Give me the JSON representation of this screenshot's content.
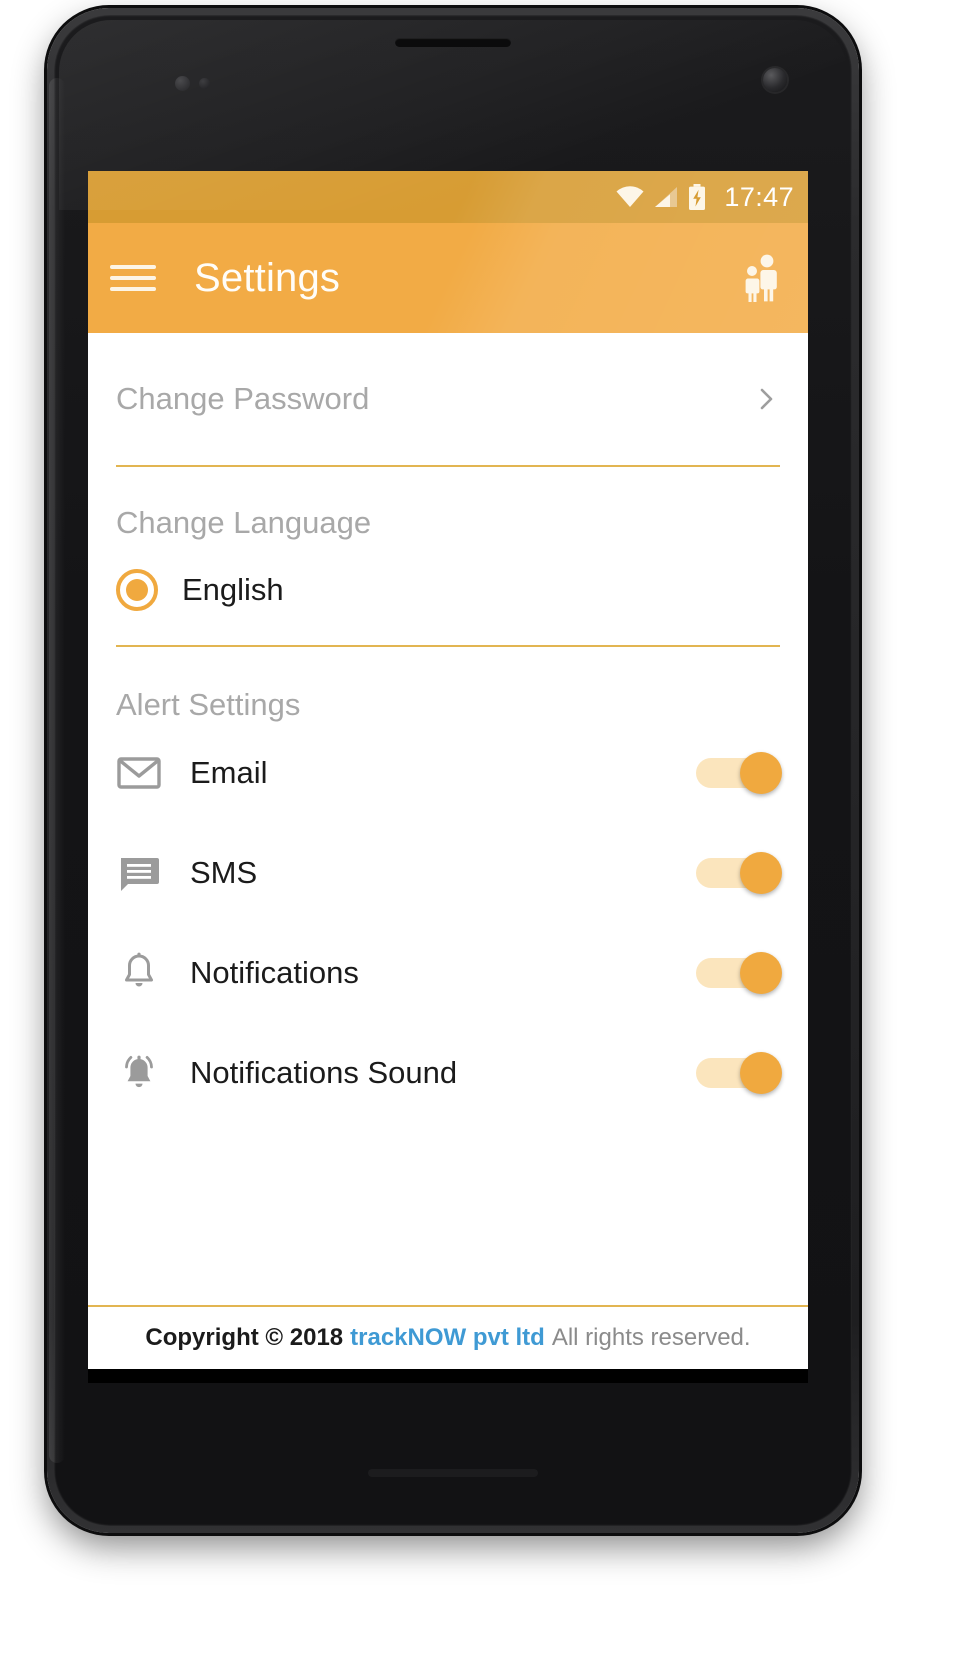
{
  "statusbar": {
    "time": "17:47",
    "icons": [
      "wifi-icon",
      "signal-icon",
      "battery-charging-icon"
    ]
  },
  "appbar": {
    "menu_icon": "hamburger-menu-icon",
    "title": "Settings",
    "right_icon": "family-icon",
    "background_color": "#f2ab45"
  },
  "content": {
    "change_password": {
      "label": "Change Password",
      "chevron_icon": "chevron-right-icon"
    },
    "change_language": {
      "heading": "Change Language",
      "options": [
        {
          "label": "English",
          "selected": true
        }
      ]
    },
    "alert_settings": {
      "heading": "Alert Settings",
      "items": [
        {
          "icon": "email-icon",
          "label": "Email",
          "enabled": true
        },
        {
          "icon": "sms-icon",
          "label": "SMS",
          "enabled": true
        },
        {
          "icon": "bell-icon",
          "label": "Notifications",
          "enabled": true
        },
        {
          "icon": "bell-ringing-icon",
          "label": "Notifications Sound",
          "enabled": true
        }
      ]
    }
  },
  "footer": {
    "copyright": "Copyright © 2018",
    "brand": "trackNOW pvt ltd",
    "rights": "All rights reserved.",
    "brand_color": "#3f9ad4"
  },
  "navbar": {
    "back": "back-triangle-icon",
    "home": "home-circle-icon",
    "recents": "recents-square-icon"
  },
  "theme": {
    "accent": "#f0a93f",
    "status_bar": "#d79c33",
    "divider": "#e2b551",
    "muted_text": "#a8a8a8"
  }
}
